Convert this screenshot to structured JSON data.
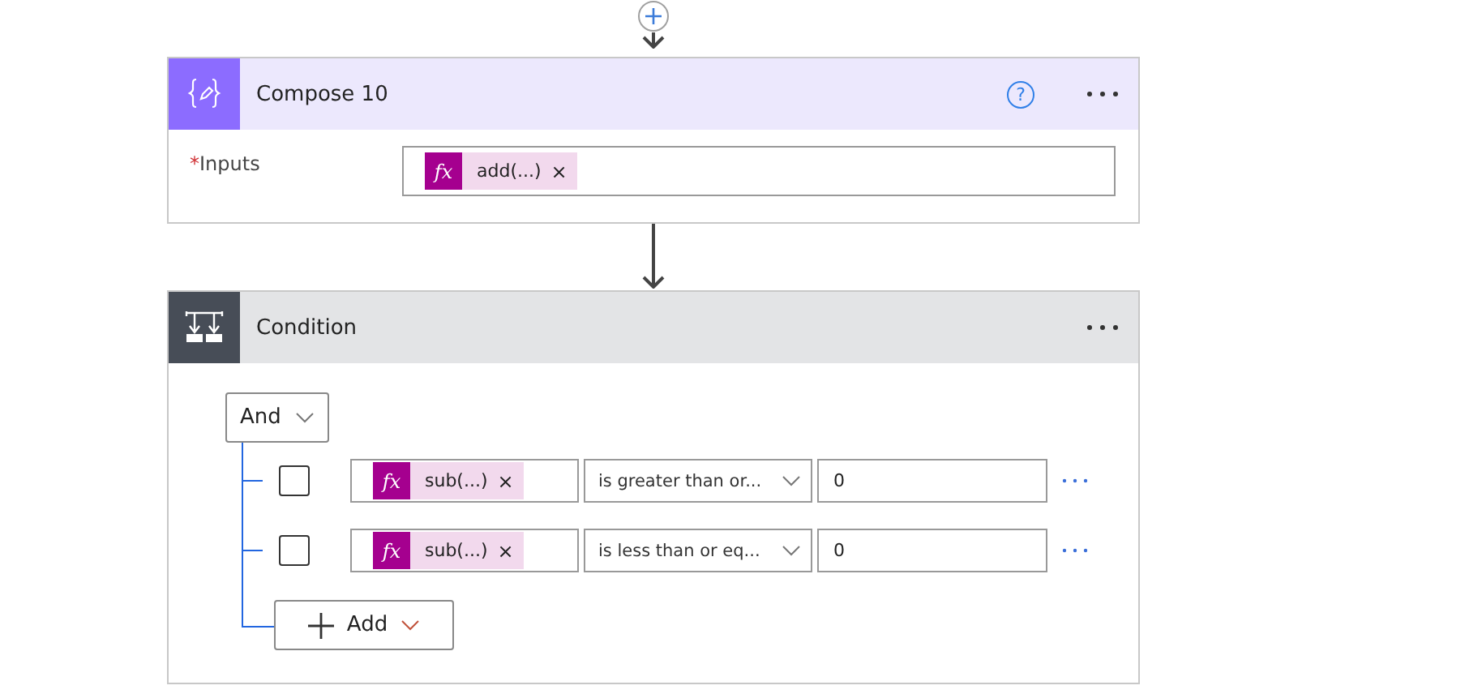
{
  "compose": {
    "title": "Compose 10",
    "help": "?",
    "inputs": {
      "required_mark": "*",
      "label": "Inputs",
      "tokens": [
        {
          "fx": "fx",
          "text": "add(...)",
          "remove": "×"
        }
      ]
    }
  },
  "condition": {
    "title": "Condition",
    "group": {
      "operator": "And"
    },
    "rows": [
      {
        "checked": false,
        "token": {
          "fx": "fx",
          "text": "sub(...)",
          "remove": "×"
        },
        "comparison": "is greater than or...",
        "value": "0"
      },
      {
        "checked": false,
        "token": {
          "fx": "fx",
          "text": "sub(...)",
          "remove": "×"
        },
        "comparison": "is less than or eq...",
        "value": "0"
      }
    ],
    "add_button": "Add"
  }
}
